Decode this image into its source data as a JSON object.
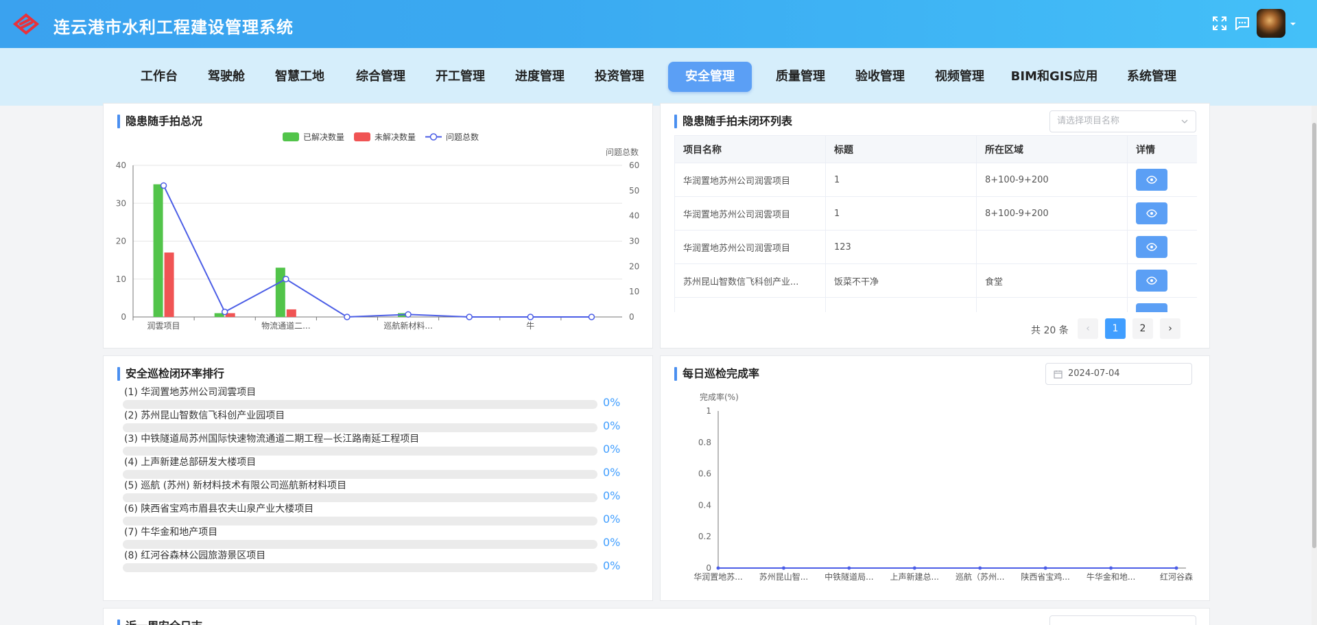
{
  "app": {
    "title": "连云港市水利工程建设管理系统"
  },
  "nav": {
    "items": [
      {
        "label": "工作台"
      },
      {
        "label": "驾驶舱"
      },
      {
        "label": "智慧工地"
      },
      {
        "label": "综合管理"
      },
      {
        "label": "开工管理"
      },
      {
        "label": "进度管理"
      },
      {
        "label": "投资管理"
      },
      {
        "label": "安全管理",
        "active": true
      },
      {
        "label": "质量管理"
      },
      {
        "label": "验收管理"
      },
      {
        "label": "视频管理"
      },
      {
        "label": "BIM和GIS应用"
      },
      {
        "label": "系统管理"
      }
    ]
  },
  "colors": {
    "accent": "#409eff",
    "resolved": "#52c44a",
    "unresolved": "#f05454",
    "line": "#4b5de6"
  },
  "hazard_overview": {
    "title": "隐患随手拍总况",
    "right_axis_label": "问题总数",
    "chart_data": {
      "type": "bar",
      "categories": [
        "润雲项目",
        "",
        "物流通道二...",
        "",
        "巡航新材料...",
        "",
        "牛",
        ""
      ],
      "series": [
        {
          "name": "已解决数量",
          "type": "bar",
          "axis": "left",
          "values": [
            35,
            1,
            13,
            0,
            1,
            0,
            0,
            0
          ]
        },
        {
          "name": "未解决数量",
          "type": "bar",
          "axis": "left",
          "values": [
            17,
            1,
            2,
            0,
            0,
            0,
            0,
            0
          ]
        },
        {
          "name": "问题总数",
          "type": "line",
          "axis": "right",
          "values": [
            52,
            2,
            15,
            0,
            1,
            0,
            0,
            0
          ]
        }
      ],
      "ylim_left": [
        0,
        40
      ],
      "yticks_left": [
        "0",
        "10",
        "20",
        "30",
        "40"
      ],
      "ylim_right": [
        0,
        60
      ],
      "yticks_right": [
        "0",
        "10",
        "20",
        "30",
        "40",
        "50",
        "60"
      ],
      "ylabel_right": "问题总数",
      "legend": "top-center",
      "grid": true
    }
  },
  "open_list": {
    "title": "隐患随手拍未闭环列表",
    "select_placeholder": "请选择项目名称",
    "columns": [
      "项目名称",
      "标题",
      "所在区域",
      "详情"
    ],
    "rows": [
      {
        "project": "华润置地苏州公司润雲项目",
        "title": "1",
        "area": "8+100-9+200"
      },
      {
        "project": "华润置地苏州公司润雲项目",
        "title": "1",
        "area": "8+100-9+200"
      },
      {
        "project": "华润置地苏州公司润雲项目",
        "title": "123",
        "area": ""
      },
      {
        "project": "苏州昆山智数信飞科创产业...",
        "title": "饭菜不干净",
        "area": "食堂"
      }
    ],
    "pager": {
      "total_text": "共 20 条",
      "pages": [
        "1",
        "2"
      ],
      "current": "1"
    }
  },
  "closure_rank": {
    "title": "安全巡检闭环率排行",
    "items": [
      {
        "label": "(1) 华润置地苏州公司润雲项目",
        "percent": "0%",
        "value": 0
      },
      {
        "label": "(2) 苏州昆山智数信飞科创产业园项目",
        "percent": "0%",
        "value": 0
      },
      {
        "label": "(3) 中铁隧道局苏州国际快速物流通道二期工程—长江路南延工程项目",
        "percent": "0%",
        "value": 0
      },
      {
        "label": "(4) 上声新建总部研发大楼项目",
        "percent": "0%",
        "value": 0
      },
      {
        "label": "(5) 巡航 (苏州) 新材料技术有限公司巡航新材料项目",
        "percent": "0%",
        "value": 0
      },
      {
        "label": "(6) 陕西省宝鸡市眉县农夫山泉产业大楼项目",
        "percent": "0%",
        "value": 0
      },
      {
        "label": "(7) 牛华金和地产项目",
        "percent": "0%",
        "value": 0
      },
      {
        "label": "(8) 红河谷森林公园旅游景区项目",
        "percent": "0%",
        "value": 0
      }
    ]
  },
  "daily_rate": {
    "title": "每日巡检完成率",
    "date": "2024-07-04",
    "chart_data": {
      "type": "line",
      "categories": [
        "华润置地苏...",
        "苏州昆山智...",
        "中铁隧道局...",
        "上声新建总...",
        "巡航（苏州...",
        "陕西省宝鸡...",
        "牛华金和地...",
        "红河谷森"
      ],
      "series": [
        {
          "values": [
            0,
            0,
            0,
            0,
            0,
            0,
            0,
            0
          ]
        }
      ],
      "ylabel": "完成率(%)",
      "ylim": [
        0,
        1
      ],
      "yticks": [
        "0",
        "0.2",
        "0.4",
        "0.6",
        "0.8",
        "1"
      ],
      "grid": false
    }
  },
  "bottom_panel": {
    "title": "近一周安全日志"
  }
}
